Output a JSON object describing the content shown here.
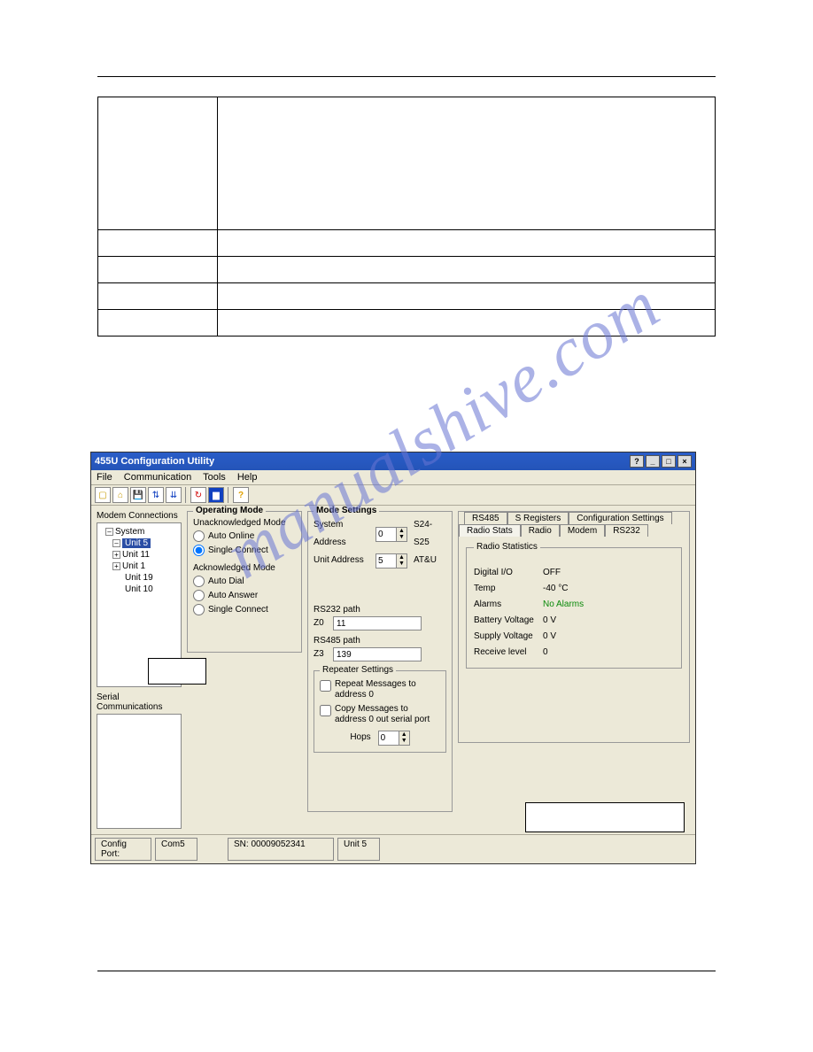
{
  "watermark_text": "manualshive.com",
  "app": {
    "title": "455U Configuration Utility",
    "menus": [
      "File",
      "Communication",
      "Tools",
      "Help"
    ],
    "toolbar_icons": [
      "new-icon",
      "open-icon",
      "save-icon",
      "seq-icon",
      "download-icon",
      "refresh-icon",
      "chart-icon",
      "help-icon"
    ],
    "tree": {
      "label": "Modem Connections",
      "root": "System",
      "units": [
        {
          "name": "Unit 5",
          "expand": "-",
          "selected": true,
          "indent": 1
        },
        {
          "name": "Unit 11",
          "expand": "+",
          "indent": 1
        },
        {
          "name": "Unit 1",
          "expand": "+",
          "indent": 1
        },
        {
          "name": "Unit 19",
          "indent": 2
        },
        {
          "name": "Unit 10",
          "indent": 2
        }
      ]
    },
    "serial_label": "Serial Communications",
    "operating_mode": {
      "title": "Operating Mode",
      "unack_label": "Unacknowledged Mode",
      "opt_auto_online": "Auto Online",
      "opt_single_connect": "Single Connect",
      "ack_label": "Acknowledged Mode",
      "opt_auto_dial": "Auto Dial",
      "opt_auto_answer": "Auto Answer",
      "opt_single_connect2": "Single Connect"
    },
    "mode_settings": {
      "title": "Mode Settings",
      "system_address": "System Address",
      "system_address_val": "0",
      "system_suffix": "S24-S25",
      "unit_address": "Unit Address",
      "unit_address_val": "5",
      "unit_suffix": "AT&U",
      "rs232_label": "RS232 path",
      "z0_label": "Z0",
      "z0_val": "11",
      "rs485_label": "RS485 path",
      "z3_label": "Z3",
      "z3_val": "139",
      "repeater_title": "Repeater Settings",
      "chk_repeat": "Repeat Messages to address 0",
      "chk_copy": "Copy Messages to address 0 out serial port",
      "hops_label": "Hops",
      "hops_val": "0"
    },
    "tabs": {
      "row1": [
        "RS485",
        "S Registers",
        "Configuration Settings"
      ],
      "row2": [
        "Radio Stats",
        "Radio",
        "Modem",
        "RS232"
      ],
      "stats_title": "Radio Statistics",
      "stats": [
        {
          "k": "Digital I/O",
          "v": "OFF"
        },
        {
          "k": "Temp",
          "v": "-40 °C"
        },
        {
          "k": "Alarms",
          "v": "No Alarms",
          "green": true
        },
        {
          "k": "Battery Voltage",
          "v": "0 V"
        },
        {
          "k": "Supply Voltage",
          "v": "0 V"
        },
        {
          "k": "Receive level",
          "v": "0"
        }
      ]
    },
    "status": {
      "config_port": "Config Port:",
      "com": "Com5",
      "sn": "SN:  00009052341",
      "unit": "Unit 5"
    }
  }
}
